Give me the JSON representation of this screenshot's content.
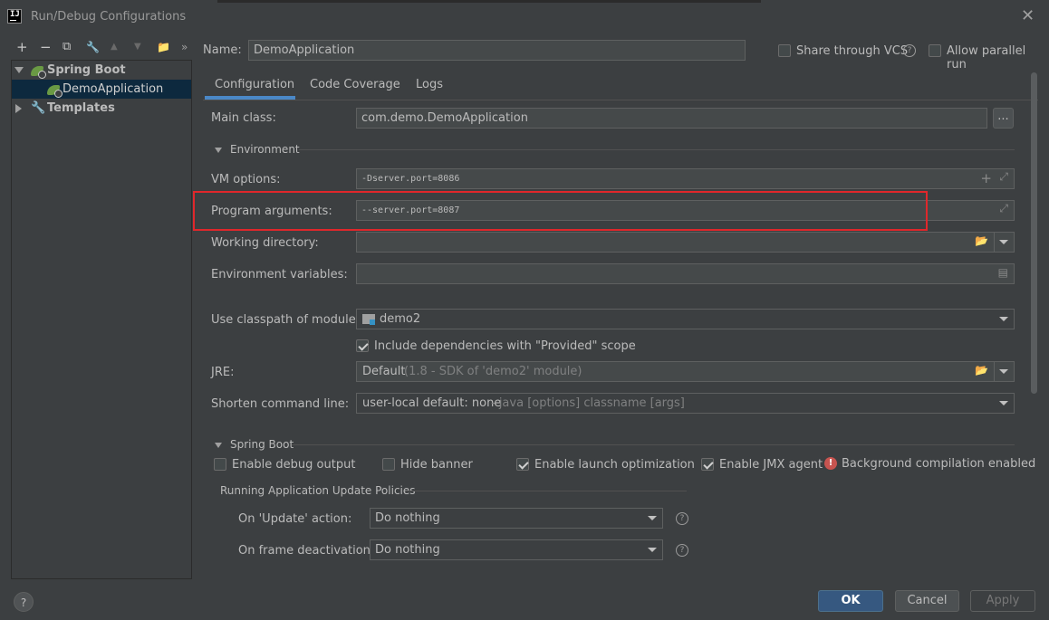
{
  "window": {
    "title": "Run/Debug Configurations",
    "app_icon": "IJ"
  },
  "toolbar": {
    "add": "+",
    "remove": "−",
    "copy": "⧉",
    "edit": "🔧",
    "up": "▲",
    "down": "▼",
    "folder": "📁",
    "more": "»"
  },
  "tree": {
    "items": [
      {
        "label": "Spring Boot"
      },
      {
        "label": "DemoApplication"
      },
      {
        "label": "Templates"
      }
    ]
  },
  "header": {
    "name_label": "Name:",
    "name_value": "DemoApplication",
    "share_vcs": "Share through VCS",
    "allow_parallel": "Allow parallel run"
  },
  "tabs": [
    {
      "label": "Configuration"
    },
    {
      "label": "Code Coverage"
    },
    {
      "label": "Logs"
    }
  ],
  "form": {
    "main_class_label": "Main class:",
    "main_class_value": "com.demo.DemoApplication",
    "browse": "...",
    "environment_section": "Environment",
    "vm_options_label": "VM options:",
    "vm_options_value": "-Dserver.port=8086",
    "program_args_label": "Program arguments:",
    "program_args_value": "--server.port=8087",
    "working_dir_label": "Working directory:",
    "env_vars_label": "Environment variables:",
    "classpath_label": "Use classpath of module:",
    "classpath_value": "demo2",
    "include_deps": "Include dependencies with \"Provided\" scope",
    "jre_label": "JRE:",
    "jre_value": "Default",
    "jre_detail": "(1.8 - SDK of 'demo2' module)",
    "shorten_label": "Shorten command line:",
    "shorten_value": "user-local default: none",
    "shorten_detail": "- java [options] classname [args]"
  },
  "springboot": {
    "section": "Spring Boot",
    "debug_output": "Enable debug output",
    "hide_banner": "Hide banner",
    "launch_opt": "Enable launch optimization",
    "jmx_agent": "Enable JMX agent",
    "bg_compile": "Background compilation enabled",
    "update_policies": "Running Application Update Policies",
    "on_update_label": "On 'Update' action:",
    "on_update_value": "Do nothing",
    "on_frame_label": "On frame deactivation:",
    "on_frame_value": "Do nothing"
  },
  "buttons": {
    "ok": "OK",
    "cancel": "Cancel",
    "apply": "Apply",
    "help": "?"
  }
}
